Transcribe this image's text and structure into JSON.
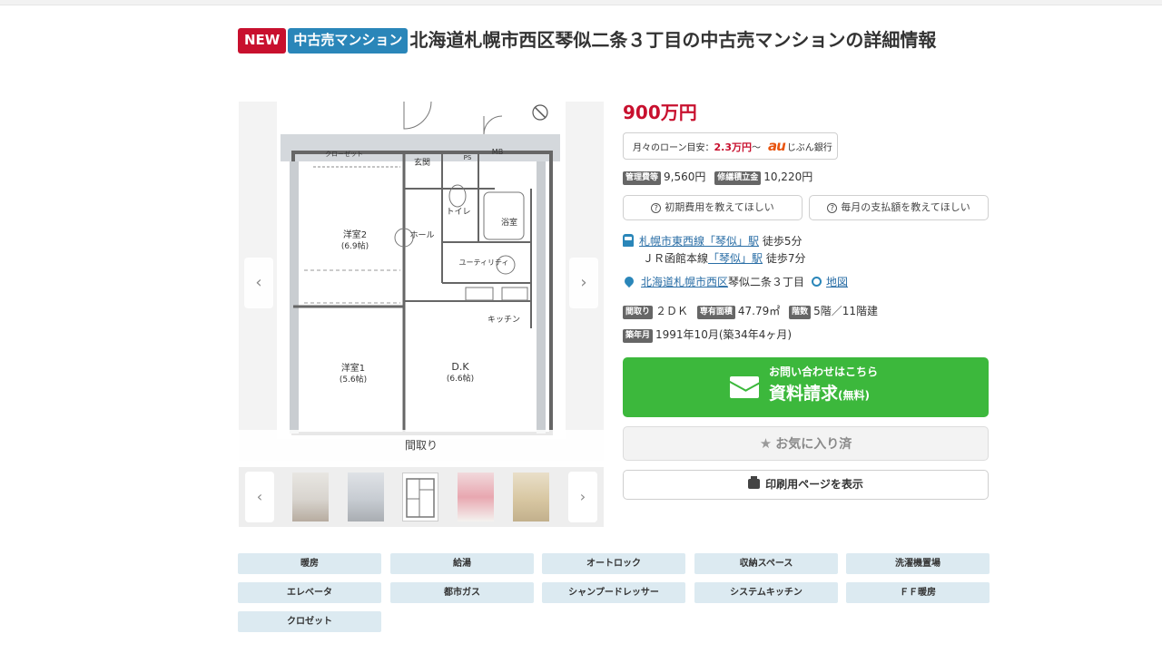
{
  "header": {
    "badge_new": "NEW",
    "badge_type": "中古売マンション",
    "title": "北海道札幌市西区琴似二条３丁目の中古売マンションの詳細情報"
  },
  "gallery": {
    "caption": "間取り",
    "prev_icon": "chevron-left-icon",
    "next_icon": "chevron-right-icon",
    "plan_labels": {
      "closet": "クローゼット",
      "entrance": "玄関",
      "ps": "PS",
      "mb": "MB",
      "room2": "洋室2",
      "room2_size": "(6.9帖)",
      "toilet": "トイレ",
      "bath": "浴室",
      "hall": "ホール",
      "utility": "ユーティリティ",
      "kitchen": "キッチン",
      "room1": "洋室1",
      "room1_size": "(5.6帖)",
      "dk": "D.K",
      "dk_size": "(6.6帖)"
    },
    "thumbnail_count": 5
  },
  "price": {
    "amount": "900万円",
    "loan_label": "月々のローン目安：",
    "loan_amount": "2.3万円",
    "loan_suffix": "〜",
    "bank_logo": "au",
    "bank_name": "じぶん銀行"
  },
  "fees": {
    "management_tag": "管理費等",
    "management_value": "9,560円",
    "repair_tag": "修繕積立金",
    "repair_value": "10,220円"
  },
  "questions": {
    "initial_cost": "初期費用を教えてほしい",
    "monthly_payment": "毎月の支払額を教えてほしい"
  },
  "access": {
    "line1": "札幌市東西線",
    "station1": "「琴似」駅",
    "walk1": " 徒歩5分",
    "line2": "ＪＲ函館本線",
    "station2": "「琴似」駅",
    "walk2": " 徒歩7分",
    "address_link": "北海道札幌市西区",
    "address_rest": "琴似二条３丁目",
    "map_link": "地図"
  },
  "specs": {
    "layout_tag": "間取り",
    "layout_value": "２ＤＫ",
    "area_tag": "専有面積",
    "area_value": "47.79㎡",
    "floor_tag": "階数",
    "floor_value": "5階／11階建",
    "built_tag": "築年月",
    "built_value": "1991年10月(築34年4ヶ月)"
  },
  "cta": {
    "sub": "お問い合わせはこちら",
    "main": "資料請求",
    "free": "(無料)"
  },
  "buttons": {
    "favorite": "お気に入り済",
    "print": "印刷用ページを表示"
  },
  "features": [
    "暖房",
    "給湯",
    "オートロック",
    "収納スペース",
    "洗濯機置場",
    "エレベータ",
    "都市ガス",
    "シャンプードレッサー",
    "システムキッチン",
    "ＦＦ暖房",
    "クロゼット"
  ],
  "colors": {
    "price_red": "#c8102e",
    "badge_blue": "#2a86b9",
    "cta_green": "#3cb83c",
    "feature_bg": "#dceaf1"
  }
}
